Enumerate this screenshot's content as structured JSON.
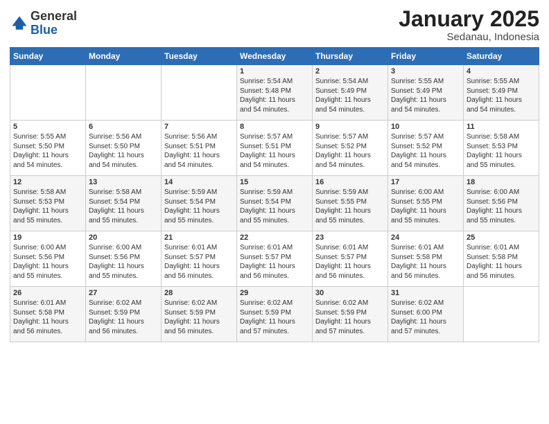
{
  "header": {
    "logo_general": "General",
    "logo_blue": "Blue",
    "month_title": "January 2025",
    "subtitle": "Sedanau, Indonesia"
  },
  "days_of_week": [
    "Sunday",
    "Monday",
    "Tuesday",
    "Wednesday",
    "Thursday",
    "Friday",
    "Saturday"
  ],
  "weeks": [
    [
      {
        "day": "",
        "info": ""
      },
      {
        "day": "",
        "info": ""
      },
      {
        "day": "",
        "info": ""
      },
      {
        "day": "1",
        "info": "Sunrise: 5:54 AM\nSunset: 5:48 PM\nDaylight: 11 hours\nand 54 minutes."
      },
      {
        "day": "2",
        "info": "Sunrise: 5:54 AM\nSunset: 5:49 PM\nDaylight: 11 hours\nand 54 minutes."
      },
      {
        "day": "3",
        "info": "Sunrise: 5:55 AM\nSunset: 5:49 PM\nDaylight: 11 hours\nand 54 minutes."
      },
      {
        "day": "4",
        "info": "Sunrise: 5:55 AM\nSunset: 5:49 PM\nDaylight: 11 hours\nand 54 minutes."
      }
    ],
    [
      {
        "day": "5",
        "info": "Sunrise: 5:55 AM\nSunset: 5:50 PM\nDaylight: 11 hours\nand 54 minutes."
      },
      {
        "day": "6",
        "info": "Sunrise: 5:56 AM\nSunset: 5:50 PM\nDaylight: 11 hours\nand 54 minutes."
      },
      {
        "day": "7",
        "info": "Sunrise: 5:56 AM\nSunset: 5:51 PM\nDaylight: 11 hours\nand 54 minutes."
      },
      {
        "day": "8",
        "info": "Sunrise: 5:57 AM\nSunset: 5:51 PM\nDaylight: 11 hours\nand 54 minutes."
      },
      {
        "day": "9",
        "info": "Sunrise: 5:57 AM\nSunset: 5:52 PM\nDaylight: 11 hours\nand 54 minutes."
      },
      {
        "day": "10",
        "info": "Sunrise: 5:57 AM\nSunset: 5:52 PM\nDaylight: 11 hours\nand 54 minutes."
      },
      {
        "day": "11",
        "info": "Sunrise: 5:58 AM\nSunset: 5:53 PM\nDaylight: 11 hours\nand 55 minutes."
      }
    ],
    [
      {
        "day": "12",
        "info": "Sunrise: 5:58 AM\nSunset: 5:53 PM\nDaylight: 11 hours\nand 55 minutes."
      },
      {
        "day": "13",
        "info": "Sunrise: 5:58 AM\nSunset: 5:54 PM\nDaylight: 11 hours\nand 55 minutes."
      },
      {
        "day": "14",
        "info": "Sunrise: 5:59 AM\nSunset: 5:54 PM\nDaylight: 11 hours\nand 55 minutes."
      },
      {
        "day": "15",
        "info": "Sunrise: 5:59 AM\nSunset: 5:54 PM\nDaylight: 11 hours\nand 55 minutes."
      },
      {
        "day": "16",
        "info": "Sunrise: 5:59 AM\nSunset: 5:55 PM\nDaylight: 11 hours\nand 55 minutes."
      },
      {
        "day": "17",
        "info": "Sunrise: 6:00 AM\nSunset: 5:55 PM\nDaylight: 11 hours\nand 55 minutes."
      },
      {
        "day": "18",
        "info": "Sunrise: 6:00 AM\nSunset: 5:56 PM\nDaylight: 11 hours\nand 55 minutes."
      }
    ],
    [
      {
        "day": "19",
        "info": "Sunrise: 6:00 AM\nSunset: 5:56 PM\nDaylight: 11 hours\nand 55 minutes."
      },
      {
        "day": "20",
        "info": "Sunrise: 6:00 AM\nSunset: 5:56 PM\nDaylight: 11 hours\nand 55 minutes."
      },
      {
        "day": "21",
        "info": "Sunrise: 6:01 AM\nSunset: 5:57 PM\nDaylight: 11 hours\nand 56 minutes."
      },
      {
        "day": "22",
        "info": "Sunrise: 6:01 AM\nSunset: 5:57 PM\nDaylight: 11 hours\nand 56 minutes."
      },
      {
        "day": "23",
        "info": "Sunrise: 6:01 AM\nSunset: 5:57 PM\nDaylight: 11 hours\nand 56 minutes."
      },
      {
        "day": "24",
        "info": "Sunrise: 6:01 AM\nSunset: 5:58 PM\nDaylight: 11 hours\nand 56 minutes."
      },
      {
        "day": "25",
        "info": "Sunrise: 6:01 AM\nSunset: 5:58 PM\nDaylight: 11 hours\nand 56 minutes."
      }
    ],
    [
      {
        "day": "26",
        "info": "Sunrise: 6:01 AM\nSunset: 5:58 PM\nDaylight: 11 hours\nand 56 minutes."
      },
      {
        "day": "27",
        "info": "Sunrise: 6:02 AM\nSunset: 5:59 PM\nDaylight: 11 hours\nand 56 minutes."
      },
      {
        "day": "28",
        "info": "Sunrise: 6:02 AM\nSunset: 5:59 PM\nDaylight: 11 hours\nand 56 minutes."
      },
      {
        "day": "29",
        "info": "Sunrise: 6:02 AM\nSunset: 5:59 PM\nDaylight: 11 hours\nand 57 minutes."
      },
      {
        "day": "30",
        "info": "Sunrise: 6:02 AM\nSunset: 5:59 PM\nDaylight: 11 hours\nand 57 minutes."
      },
      {
        "day": "31",
        "info": "Sunrise: 6:02 AM\nSunset: 6:00 PM\nDaylight: 11 hours\nand 57 minutes."
      },
      {
        "day": "",
        "info": ""
      }
    ]
  ]
}
